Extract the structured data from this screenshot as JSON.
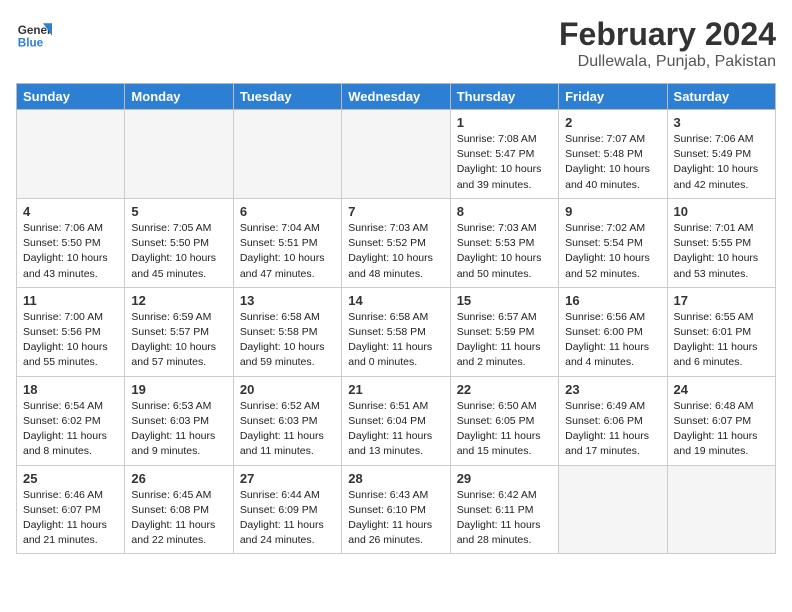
{
  "header": {
    "logo_general": "General",
    "logo_blue": "Blue",
    "month_title": "February 2024",
    "location": "Dullewala, Punjab, Pakistan"
  },
  "weekdays": [
    "Sunday",
    "Monday",
    "Tuesday",
    "Wednesday",
    "Thursday",
    "Friday",
    "Saturday"
  ],
  "weeks": [
    [
      {
        "day": "",
        "info": ""
      },
      {
        "day": "",
        "info": ""
      },
      {
        "day": "",
        "info": ""
      },
      {
        "day": "",
        "info": ""
      },
      {
        "day": "1",
        "info": "Sunrise: 7:08 AM\nSunset: 5:47 PM\nDaylight: 10 hours\nand 39 minutes."
      },
      {
        "day": "2",
        "info": "Sunrise: 7:07 AM\nSunset: 5:48 PM\nDaylight: 10 hours\nand 40 minutes."
      },
      {
        "day": "3",
        "info": "Sunrise: 7:06 AM\nSunset: 5:49 PM\nDaylight: 10 hours\nand 42 minutes."
      }
    ],
    [
      {
        "day": "4",
        "info": "Sunrise: 7:06 AM\nSunset: 5:50 PM\nDaylight: 10 hours\nand 43 minutes."
      },
      {
        "day": "5",
        "info": "Sunrise: 7:05 AM\nSunset: 5:50 PM\nDaylight: 10 hours\nand 45 minutes."
      },
      {
        "day": "6",
        "info": "Sunrise: 7:04 AM\nSunset: 5:51 PM\nDaylight: 10 hours\nand 47 minutes."
      },
      {
        "day": "7",
        "info": "Sunrise: 7:03 AM\nSunset: 5:52 PM\nDaylight: 10 hours\nand 48 minutes."
      },
      {
        "day": "8",
        "info": "Sunrise: 7:03 AM\nSunset: 5:53 PM\nDaylight: 10 hours\nand 50 minutes."
      },
      {
        "day": "9",
        "info": "Sunrise: 7:02 AM\nSunset: 5:54 PM\nDaylight: 10 hours\nand 52 minutes."
      },
      {
        "day": "10",
        "info": "Sunrise: 7:01 AM\nSunset: 5:55 PM\nDaylight: 10 hours\nand 53 minutes."
      }
    ],
    [
      {
        "day": "11",
        "info": "Sunrise: 7:00 AM\nSunset: 5:56 PM\nDaylight: 10 hours\nand 55 minutes."
      },
      {
        "day": "12",
        "info": "Sunrise: 6:59 AM\nSunset: 5:57 PM\nDaylight: 10 hours\nand 57 minutes."
      },
      {
        "day": "13",
        "info": "Sunrise: 6:58 AM\nSunset: 5:58 PM\nDaylight: 10 hours\nand 59 minutes."
      },
      {
        "day": "14",
        "info": "Sunrise: 6:58 AM\nSunset: 5:58 PM\nDaylight: 11 hours\nand 0 minutes."
      },
      {
        "day": "15",
        "info": "Sunrise: 6:57 AM\nSunset: 5:59 PM\nDaylight: 11 hours\nand 2 minutes."
      },
      {
        "day": "16",
        "info": "Sunrise: 6:56 AM\nSunset: 6:00 PM\nDaylight: 11 hours\nand 4 minutes."
      },
      {
        "day": "17",
        "info": "Sunrise: 6:55 AM\nSunset: 6:01 PM\nDaylight: 11 hours\nand 6 minutes."
      }
    ],
    [
      {
        "day": "18",
        "info": "Sunrise: 6:54 AM\nSunset: 6:02 PM\nDaylight: 11 hours\nand 8 minutes."
      },
      {
        "day": "19",
        "info": "Sunrise: 6:53 AM\nSunset: 6:03 PM\nDaylight: 11 hours\nand 9 minutes."
      },
      {
        "day": "20",
        "info": "Sunrise: 6:52 AM\nSunset: 6:03 PM\nDaylight: 11 hours\nand 11 minutes."
      },
      {
        "day": "21",
        "info": "Sunrise: 6:51 AM\nSunset: 6:04 PM\nDaylight: 11 hours\nand 13 minutes."
      },
      {
        "day": "22",
        "info": "Sunrise: 6:50 AM\nSunset: 6:05 PM\nDaylight: 11 hours\nand 15 minutes."
      },
      {
        "day": "23",
        "info": "Sunrise: 6:49 AM\nSunset: 6:06 PM\nDaylight: 11 hours\nand 17 minutes."
      },
      {
        "day": "24",
        "info": "Sunrise: 6:48 AM\nSunset: 6:07 PM\nDaylight: 11 hours\nand 19 minutes."
      }
    ],
    [
      {
        "day": "25",
        "info": "Sunrise: 6:46 AM\nSunset: 6:07 PM\nDaylight: 11 hours\nand 21 minutes."
      },
      {
        "day": "26",
        "info": "Sunrise: 6:45 AM\nSunset: 6:08 PM\nDaylight: 11 hours\nand 22 minutes."
      },
      {
        "day": "27",
        "info": "Sunrise: 6:44 AM\nSunset: 6:09 PM\nDaylight: 11 hours\nand 24 minutes."
      },
      {
        "day": "28",
        "info": "Sunrise: 6:43 AM\nSunset: 6:10 PM\nDaylight: 11 hours\nand 26 minutes."
      },
      {
        "day": "29",
        "info": "Sunrise: 6:42 AM\nSunset: 6:11 PM\nDaylight: 11 hours\nand 28 minutes."
      },
      {
        "day": "",
        "info": ""
      },
      {
        "day": "",
        "info": ""
      }
    ]
  ]
}
